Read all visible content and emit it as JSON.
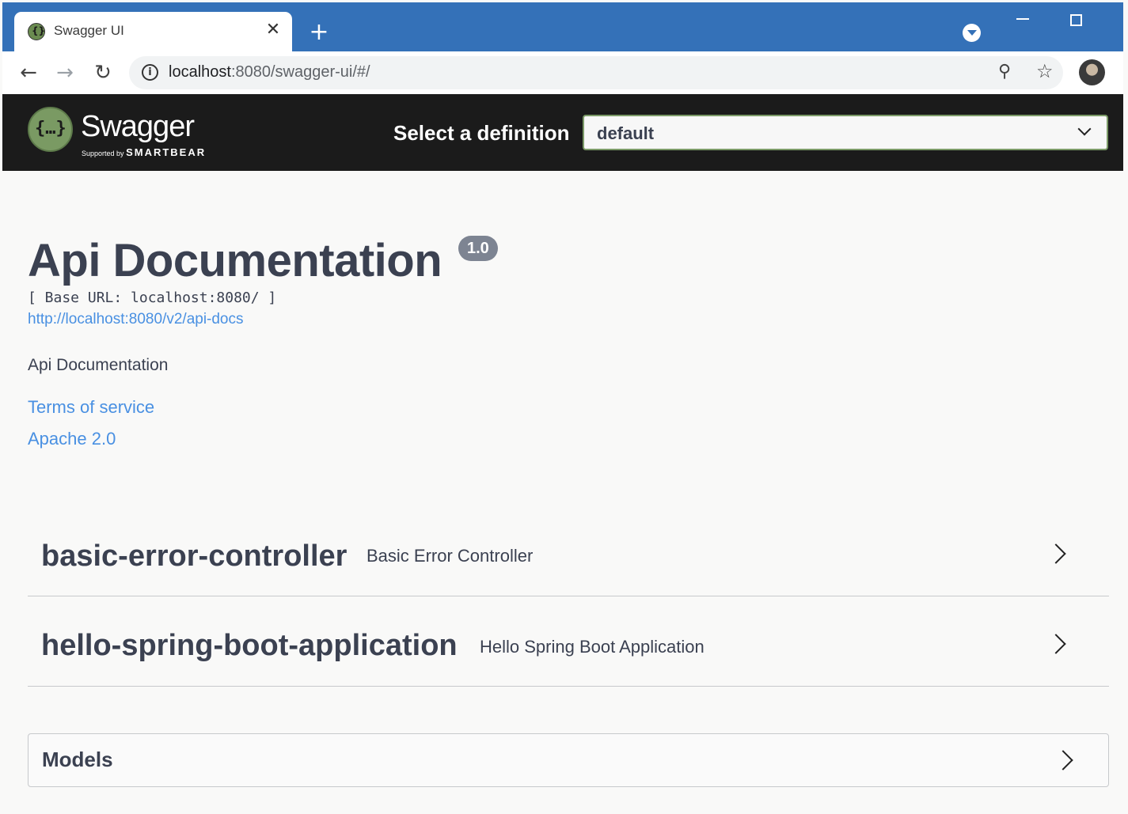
{
  "browser": {
    "tab_title": "Swagger UI",
    "tab_close": "✕",
    "new_tab": "+",
    "url_host": "localhost",
    "url_rest": ":8080/swagger-ui/#/",
    "icons": [
      "back-icon",
      "forward-icon",
      "reload-icon",
      "info-icon",
      "zoom-icon",
      "star-icon",
      "avatar"
    ]
  },
  "topbar": {
    "logo_text": "Swagger",
    "logo_sub_small": "Supported by",
    "logo_sub_brand": "SMARTBEAR",
    "definition_label": "Select a definition",
    "definition_value": "default"
  },
  "info": {
    "title": "Api Documentation",
    "version": "1.0",
    "base_url": "[ Base URL: localhost:8080/ ]",
    "api_docs_link": "http://localhost:8080/v2/api-docs",
    "description": "Api Documentation",
    "terms_link": "Terms of service",
    "license_link": "Apache 2.0"
  },
  "tags": [
    {
      "name": "basic-error-controller",
      "description": "Basic Error Controller"
    },
    {
      "name": "hello-spring-boot-application",
      "description": "Hello Spring Boot Application"
    }
  ],
  "models": {
    "label": "Models"
  },
  "colors": {
    "tabstrip": "#3471b8",
    "topbar": "#1b1b1b",
    "logo_green": "#7a9a63",
    "link_blue": "#4990e2",
    "text_dark": "#3b4151"
  }
}
